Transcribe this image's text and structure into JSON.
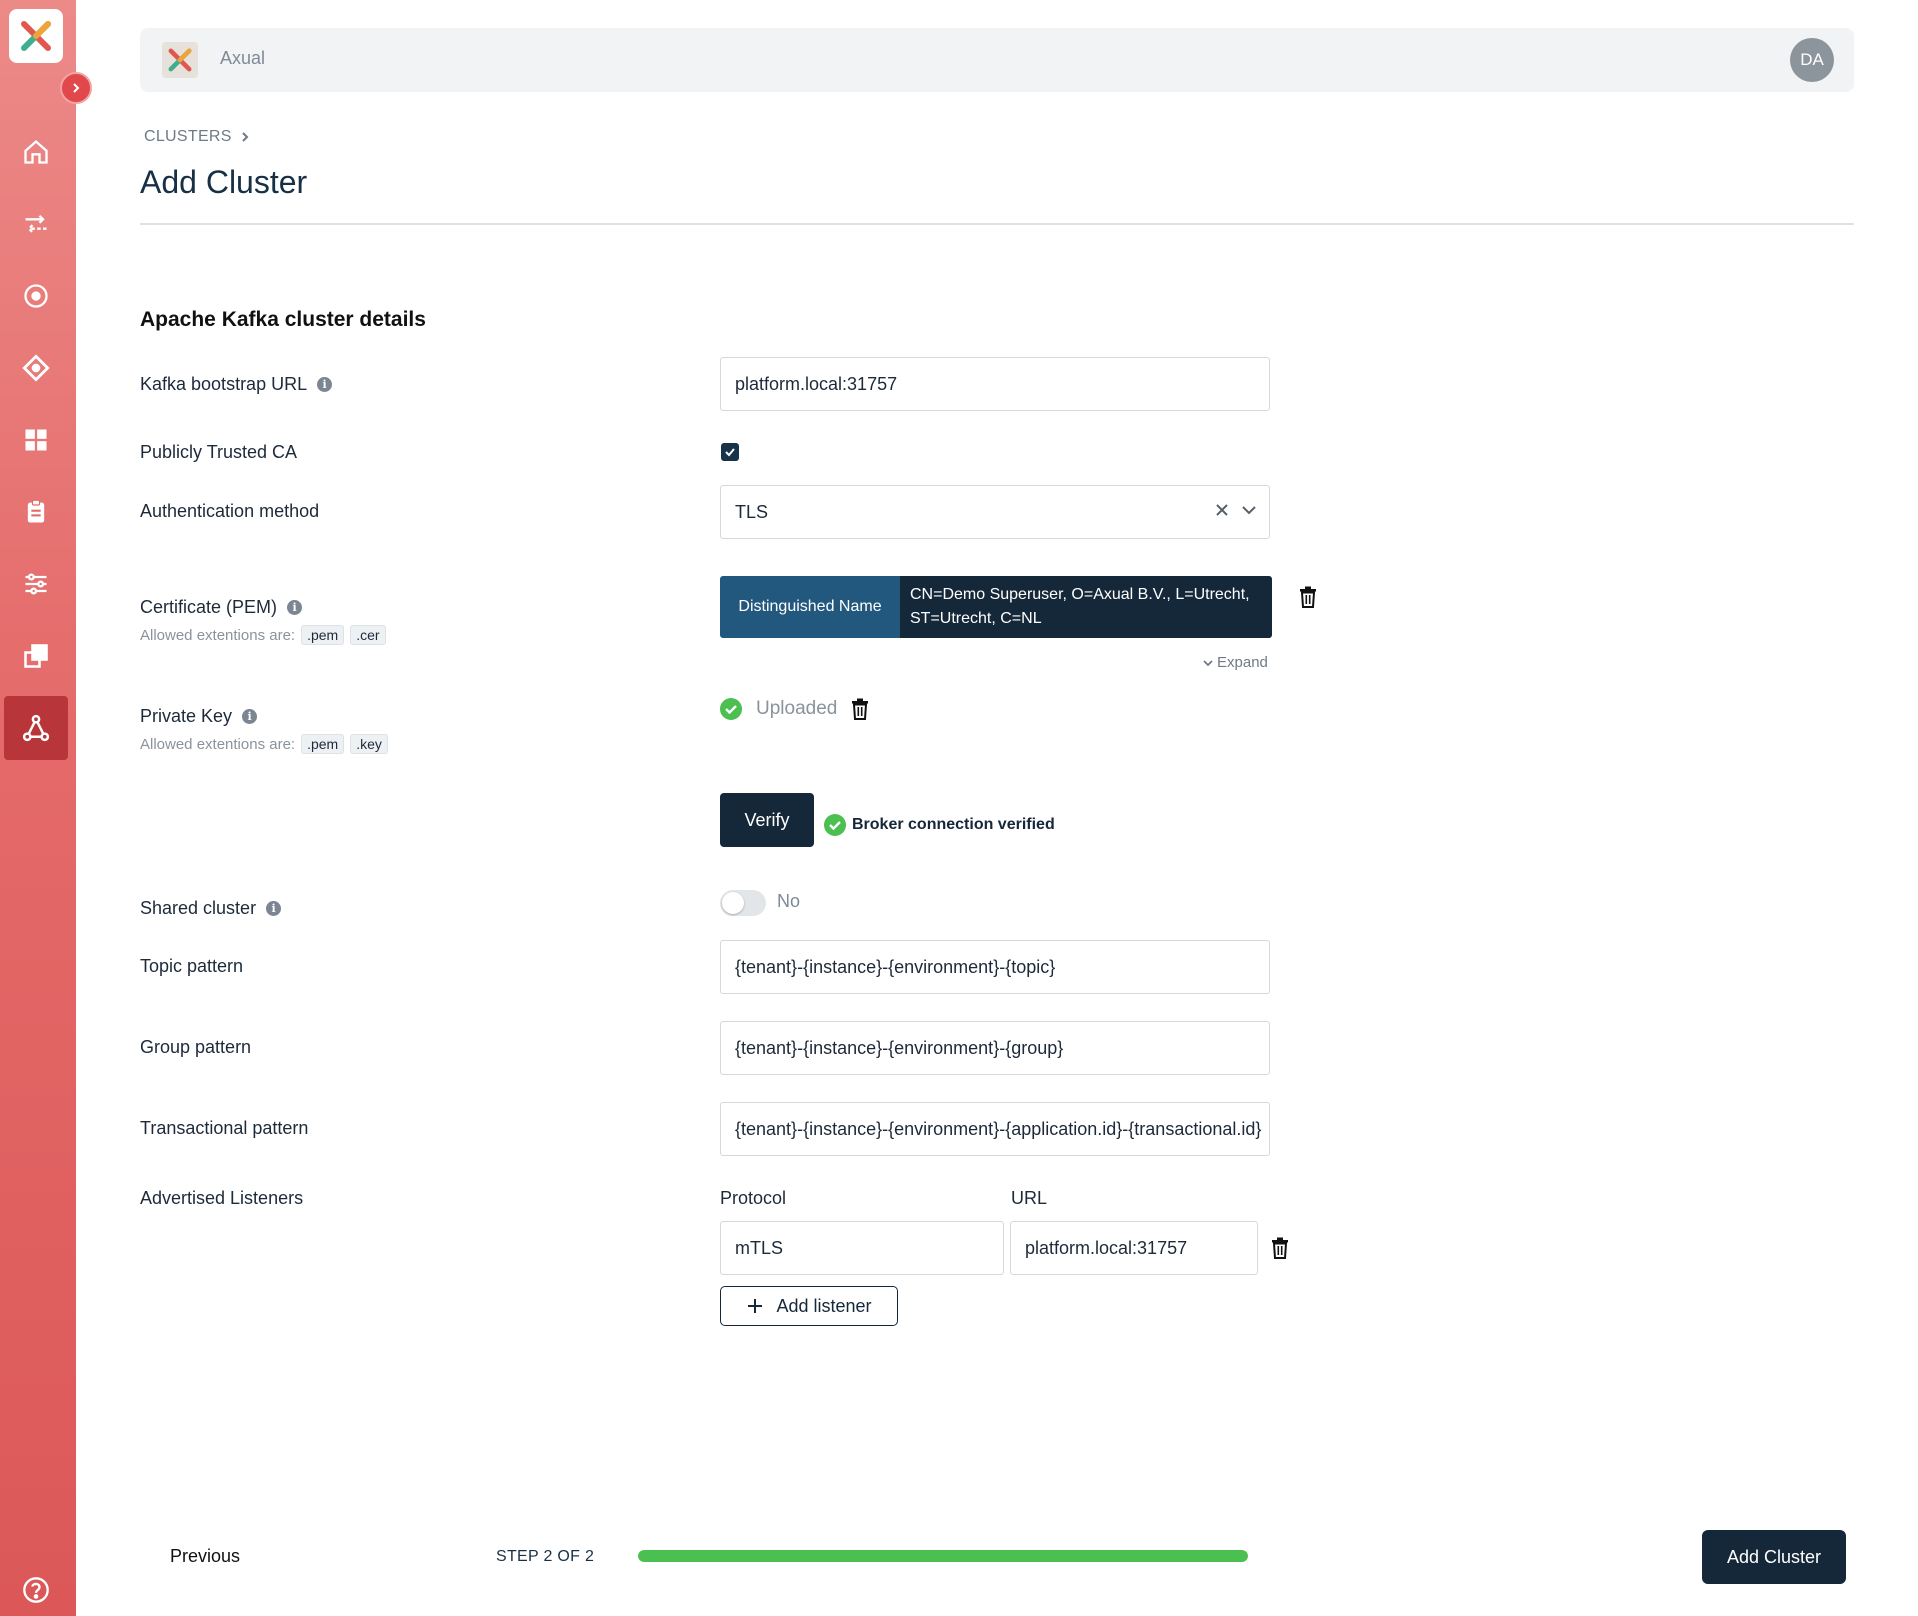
{
  "topbar": {
    "title": "Axual",
    "avatar_initials": "DA"
  },
  "breadcrumb": {
    "item": "CLUSTERS"
  },
  "page_title": "Add Cluster",
  "section_title": "Apache Kafka cluster details",
  "fields": {
    "bootstrap": {
      "label": "Kafka bootstrap URL",
      "value": "platform.local:31757"
    },
    "trusted_ca": {
      "label": "Publicly Trusted CA",
      "checked": true
    },
    "auth": {
      "label": "Authentication method",
      "value": "TLS"
    },
    "certificate": {
      "label": "Certificate (PEM)",
      "allowed_label": "Allowed extentions are:",
      "ext1": ".pem",
      "ext2": ".cer",
      "dn_key": "Distinguished Name",
      "dn_value_line1": "CN=Demo Superuser, O=Axual B.V., L=Utrecht,",
      "dn_value_line2": "ST=Utrecht, C=NL",
      "expand_label": "Expand"
    },
    "private_key": {
      "label": "Private Key",
      "allowed_label": "Allowed extentions are:",
      "ext1": ".pem",
      "ext2": ".key",
      "status": "Uploaded"
    },
    "verify": {
      "button_label": "Verify",
      "status": "Broker connection verified"
    },
    "shared": {
      "label": "Shared cluster",
      "value_label": "No",
      "on": false
    },
    "topic_pattern": {
      "label": "Topic pattern",
      "value": "{tenant}-{instance}-{environment}-{topic}"
    },
    "group_pattern": {
      "label": "Group pattern",
      "value": "{tenant}-{instance}-{environment}-{group}"
    },
    "transactional_pattern": {
      "label": "Transactional pattern",
      "value": "{tenant}-{instance}-{environment}-{application.id}-{transactional.id}"
    },
    "listeners": {
      "label": "Advertised Listeners",
      "protocol_header": "Protocol",
      "url_header": "URL",
      "rows": [
        {
          "protocol": "mTLS",
          "url": "platform.local:31757"
        }
      ],
      "add_label": "Add listener"
    }
  },
  "footer": {
    "previous_label": "Previous",
    "step_label": "STEP 2 OF 2",
    "progress": 1.0,
    "submit_label": "Add Cluster"
  },
  "colors": {
    "sidebar": "#e46a69",
    "primary": "#15283a",
    "success": "#4bbf4f"
  },
  "icons": {
    "sidebar": [
      "home-icon",
      "streams-icon",
      "target-icon",
      "diamond-icon",
      "dashboard-icon",
      "clipboard-icon",
      "sliders-icon",
      "copy-icon",
      "cluster-icon"
    ],
    "help": "help-icon"
  }
}
